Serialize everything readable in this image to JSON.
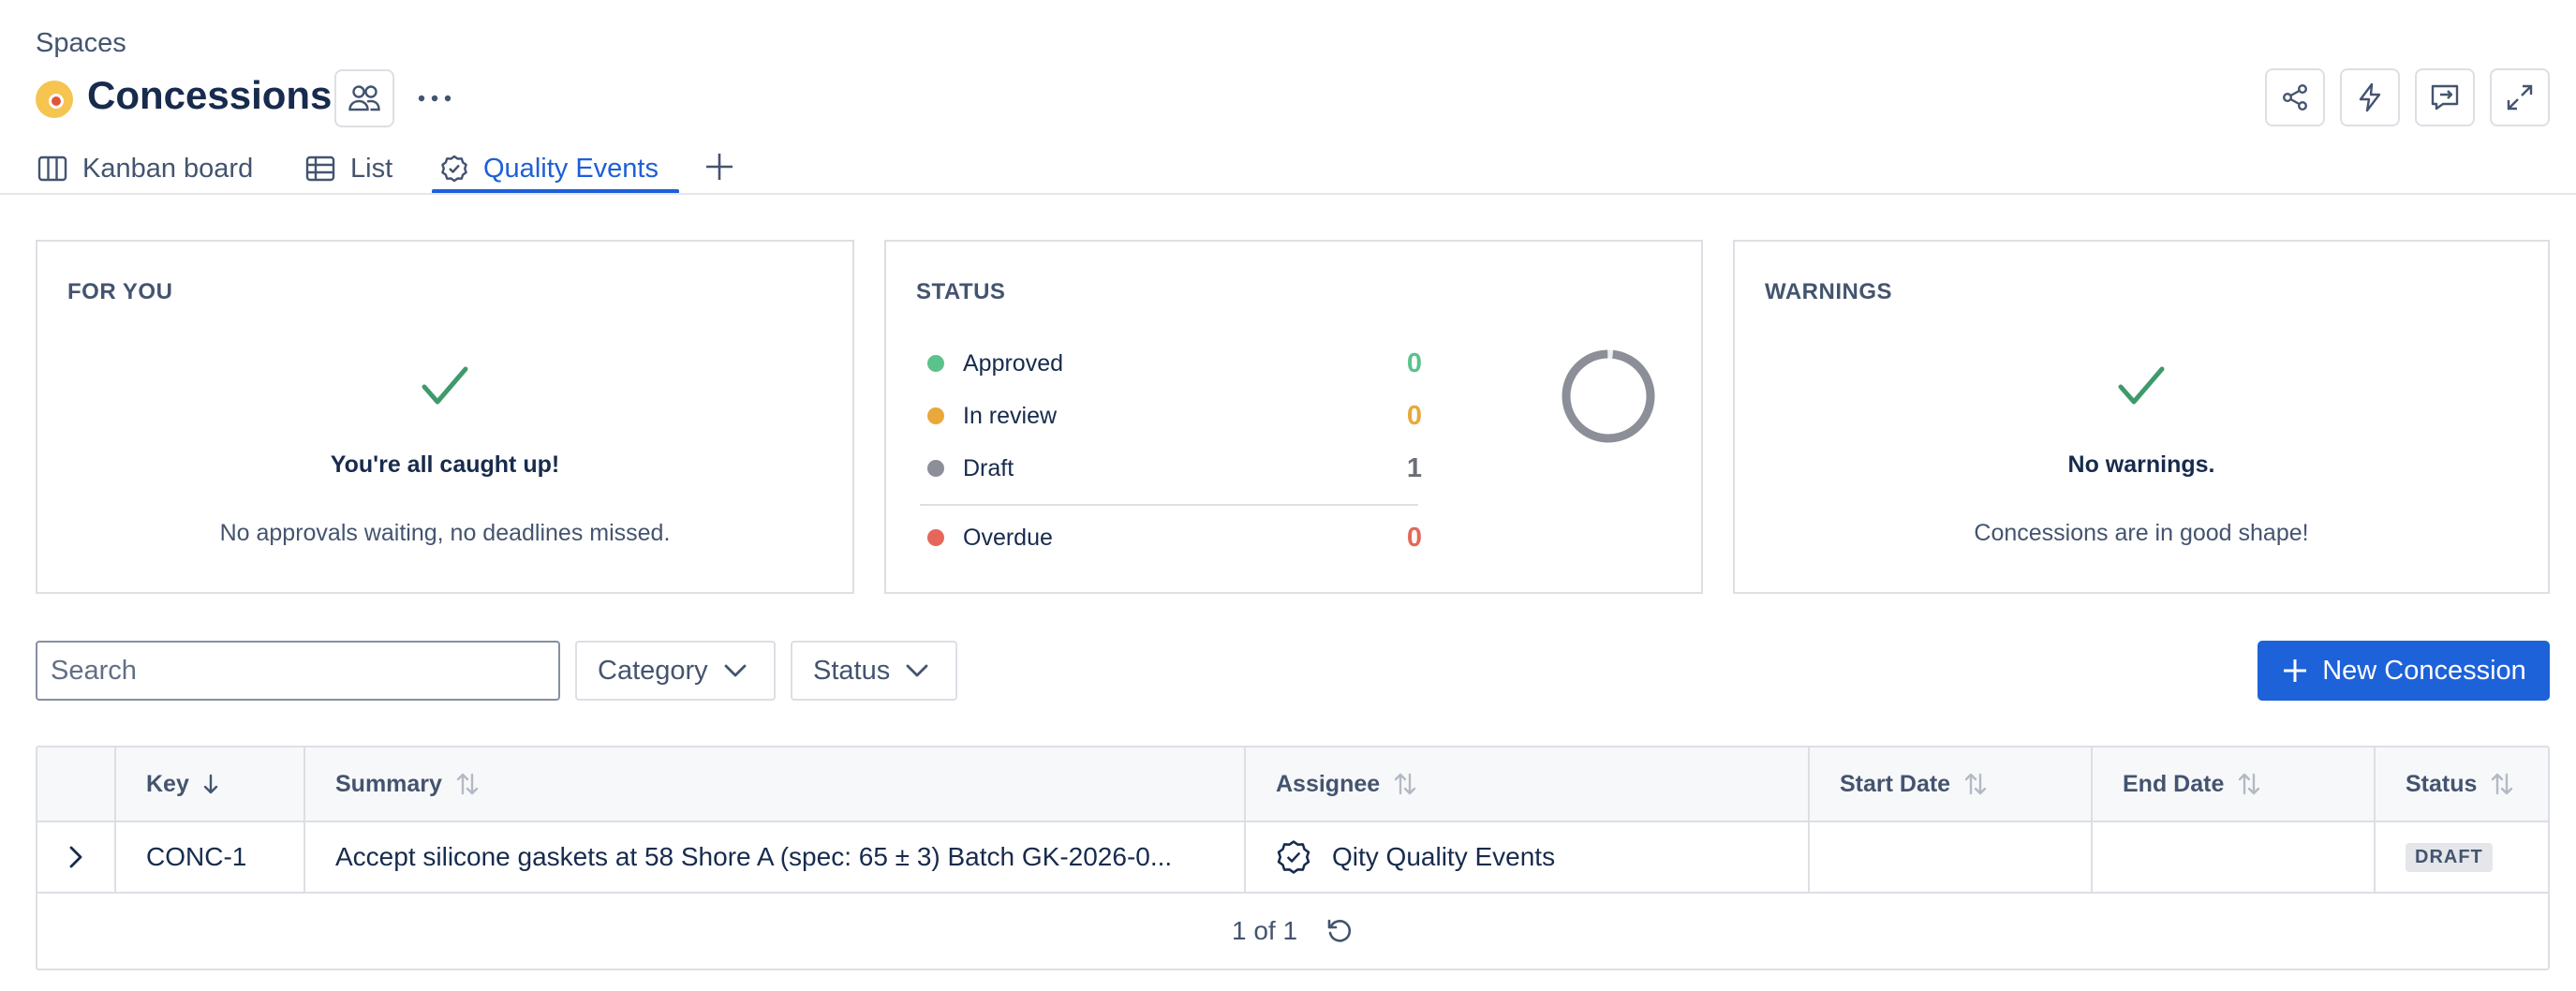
{
  "breadcrumb": "Spaces",
  "space": {
    "title": "Concessions"
  },
  "tabs": [
    {
      "label": "Kanban board",
      "icon": "columns-icon"
    },
    {
      "label": "List",
      "icon": "table-icon"
    },
    {
      "label": "Quality Events",
      "icon": "badge-check-icon",
      "active": true
    }
  ],
  "cards": {
    "for_you": {
      "title": "FOR YOU",
      "heading": "You're all caught up!",
      "subtext": "No approvals waiting, no deadlines missed."
    },
    "status": {
      "title": "STATUS",
      "rows": [
        {
          "label": "Approved",
          "count": "0",
          "color": "#5cc28b"
        },
        {
          "label": "In review",
          "count": "0",
          "color": "#e8a83a"
        },
        {
          "label": "Draft",
          "count": "1",
          "color": "#8c8f97"
        }
      ],
      "overdue": {
        "label": "Overdue",
        "count": "0",
        "color": "#e5675b"
      },
      "donut_fraction": 1
    },
    "warnings": {
      "title": "WARNINGS",
      "heading": "No warnings.",
      "subtext": "Concessions are in good shape!"
    }
  },
  "filters": {
    "search_placeholder": "Search",
    "category_label": "Category",
    "status_label": "Status",
    "new_button_label": "New Concession"
  },
  "table": {
    "columns": [
      "Key",
      "Summary",
      "Assignee",
      "Start Date",
      "End Date",
      "Status"
    ],
    "rows": [
      {
        "key": "CONC-1",
        "summary": "Accept silicone gaskets at 58 Shore A (spec: 65 ± 3) Batch GK-2026-0...",
        "assignee": "Qity Quality Events",
        "start_date": "",
        "end_date": "",
        "status": "DRAFT"
      }
    ],
    "pagination": "1 of 1"
  },
  "colors": {
    "accent": "#1d62d8",
    "check": "#3f9a6b"
  }
}
